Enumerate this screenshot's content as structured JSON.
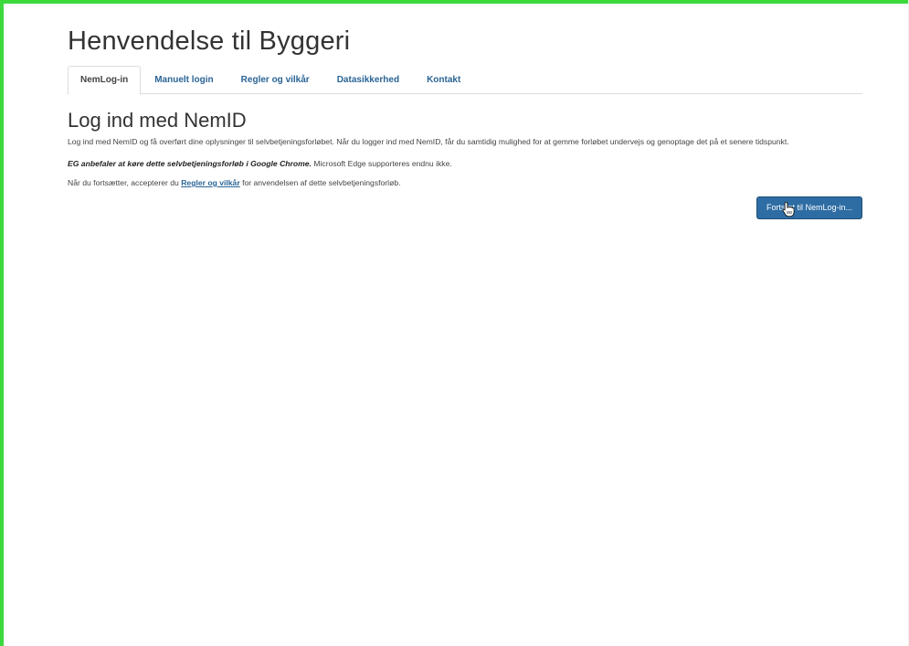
{
  "header": {
    "title": "Henvendelse til Byggeri"
  },
  "tabs": [
    {
      "label": "NemLog-in",
      "active": true
    },
    {
      "label": "Manuelt login",
      "active": false
    },
    {
      "label": "Regler og vilkår",
      "active": false
    },
    {
      "label": "Datasikkerhed",
      "active": false
    },
    {
      "label": "Kontakt",
      "active": false
    }
  ],
  "main": {
    "heading": "Log ind med NemID",
    "intro": "Log ind med NemID og få overført dine oplysninger til selvbetjeningsforløbet. Når du logger ind med NemID, får du samtidig mulighed for at gemme forløbet undervejs og genoptage det på et senere tidspunkt.",
    "browser_note_emphasis": "EG anbefaler at køre dette selvbetjeningsforløb i Google Chrome.",
    "browser_note_rest": " Microsoft Edge supporteres endnu ikke.",
    "terms_prefix": "Når du fortsætter, accepterer du ",
    "terms_link": "Regler og vilkår",
    "terms_suffix": " for anvendelsen af dette selvbetjeningsforløb.",
    "continue_label": "Fortsæt til NemLog-in..."
  },
  "colors": {
    "frame_border": "#3cd93c",
    "link": "#2a6496",
    "primary_button": "#2e6da4"
  },
  "icons": {
    "cursor": "hand-pointer-icon"
  }
}
